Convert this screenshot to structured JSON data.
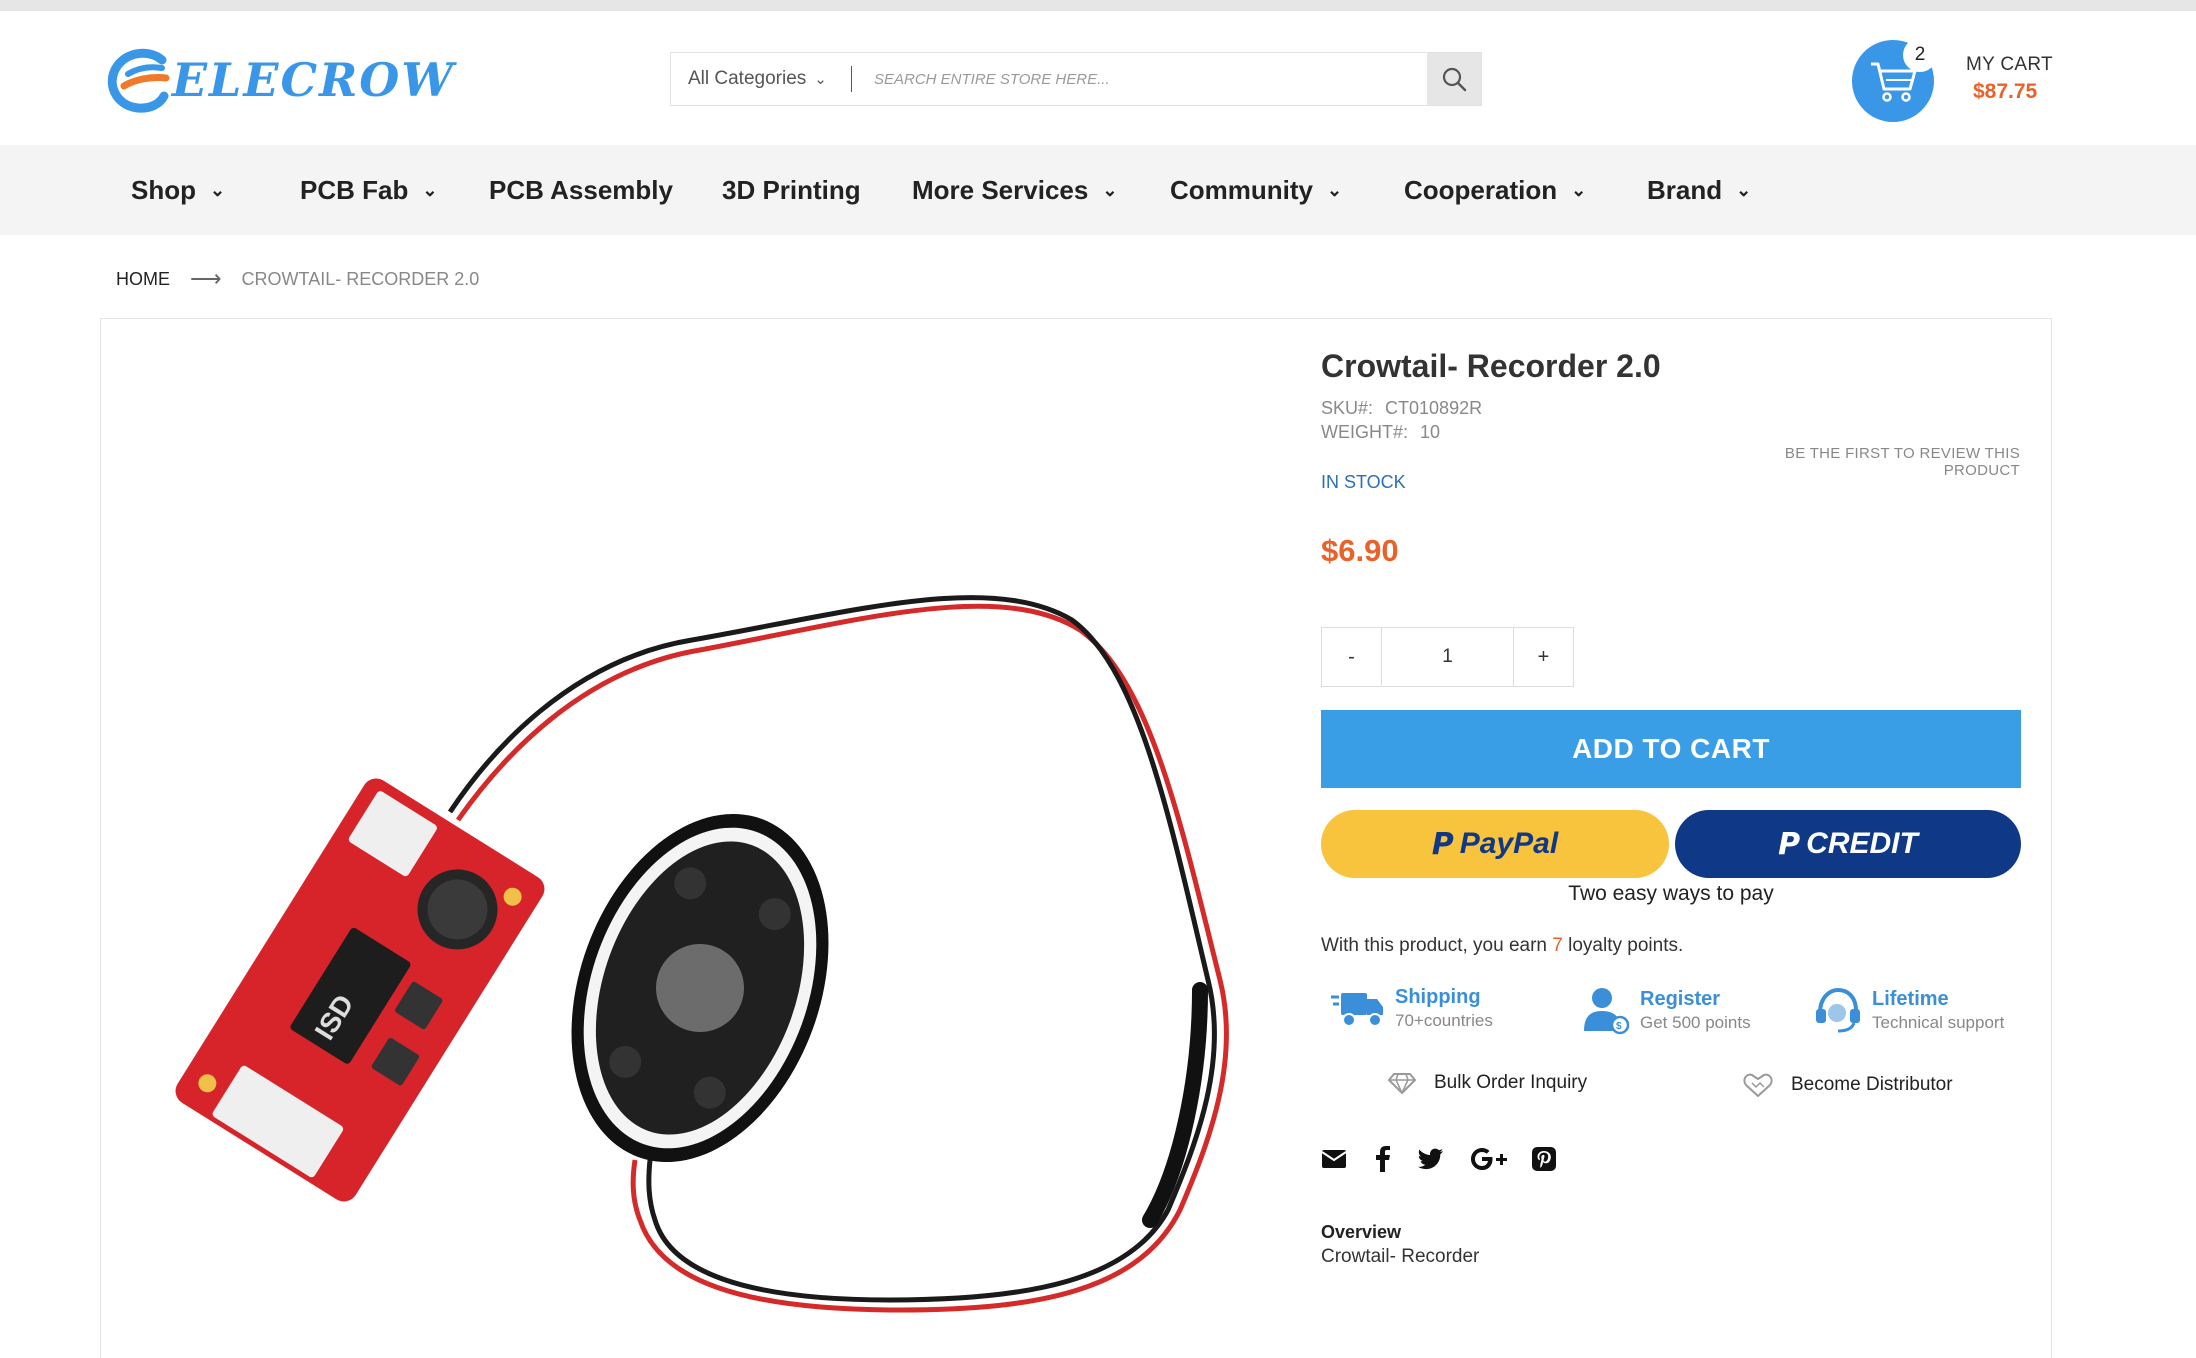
{
  "header": {
    "logo_text": "ELECROW",
    "search": {
      "category": "All Categories",
      "placeholder": "SEARCH ENTIRE STORE HERE..."
    },
    "cart": {
      "count": "2",
      "label": "MY CART",
      "total": "$87.75"
    }
  },
  "nav": {
    "items": [
      {
        "label": "Shop",
        "has_dropdown": true
      },
      {
        "label": "PCB Fab",
        "has_dropdown": true
      },
      {
        "label": "PCB Assembly",
        "has_dropdown": false
      },
      {
        "label": "3D Printing",
        "has_dropdown": false
      },
      {
        "label": "More Services",
        "has_dropdown": true
      },
      {
        "label": "Community",
        "has_dropdown": true
      },
      {
        "label": "Cooperation",
        "has_dropdown": true
      },
      {
        "label": "Brand",
        "has_dropdown": true
      }
    ]
  },
  "breadcrumb": {
    "home": "HOME",
    "current": "CROWTAIL- RECORDER 2.0"
  },
  "product": {
    "title": "Crowtail- Recorder 2.0",
    "sku_label": "SKU#:",
    "sku": "CT010892R",
    "weight_label": "WEIGHT#:",
    "weight": "10",
    "review_link": "BE THE FIRST TO REVIEW THIS PRODUCT",
    "stock": "IN STOCK",
    "price": "$6.90",
    "qty_minus": "-",
    "qty": "1",
    "qty_plus": "+",
    "add_to_cart": "ADD TO CART",
    "paypal_label": "PayPal",
    "credit_label": "CREDIT",
    "pay_note": "Two easy ways to pay",
    "loyalty_pre": "With this product, you earn ",
    "loyalty_points": "7",
    "loyalty_post": " loyalty points.",
    "features": [
      {
        "title": "Shipping",
        "sub": "70+countries",
        "icon": "truck-icon"
      },
      {
        "title": "Register",
        "sub": "Get 500 points",
        "icon": "user-icon"
      },
      {
        "title": "Lifetime",
        "sub": "Technical support",
        "icon": "headset-icon"
      }
    ],
    "bulk_order": "Bulk Order Inquiry",
    "distributor": "Become Distributor",
    "overview_heading": "Overview",
    "overview_text": "Crowtail- Recorder"
  },
  "colors": {
    "brand_blue": "#3a96e6",
    "price_orange": "#e8622a",
    "paypal_yellow": "#f8c33d",
    "credit_navy": "#0f3887"
  }
}
